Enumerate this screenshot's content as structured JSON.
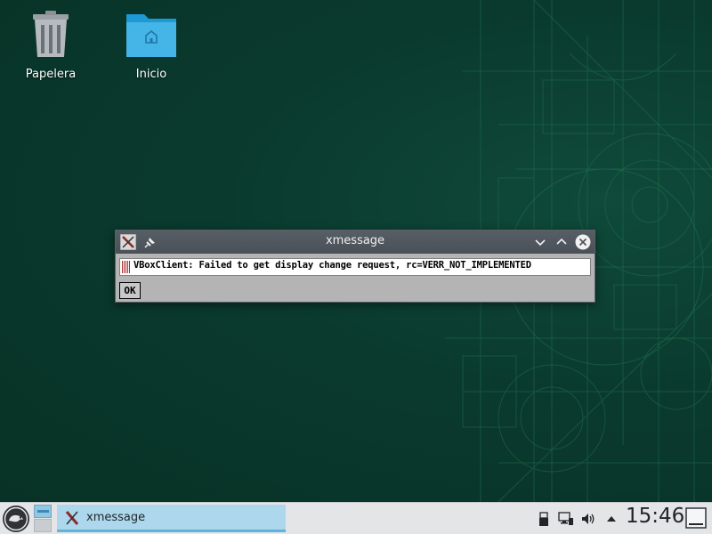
{
  "desktop": {
    "icons": [
      {
        "name": "trash",
        "label": "Papelera"
      },
      {
        "name": "home",
        "label": "Inicio"
      }
    ],
    "colors": {
      "background": "#0a3a2e",
      "blueprint_lines": "#1f6e4a"
    }
  },
  "window": {
    "title": "xmessage",
    "message": "VBoxClient: Failed to get display change request, rc=VERR_NOT_IMPLEMENTED",
    "ok_label": "OK",
    "titlebar_buttons": [
      "pin-icon",
      "minimize-icon",
      "maximize-icon",
      "close-icon"
    ]
  },
  "taskbar": {
    "tasks": [
      {
        "label": "xmessage",
        "icon": "x-logo-icon",
        "active": true
      }
    ],
    "tray": [
      "usb-icon",
      "network-icon",
      "volume-icon",
      "expand-tray-icon"
    ],
    "clock": "15:46",
    "colors": {
      "background": "#e3e5e7",
      "active_task": "#acd7ec",
      "accent": "#5fb3de"
    }
  }
}
